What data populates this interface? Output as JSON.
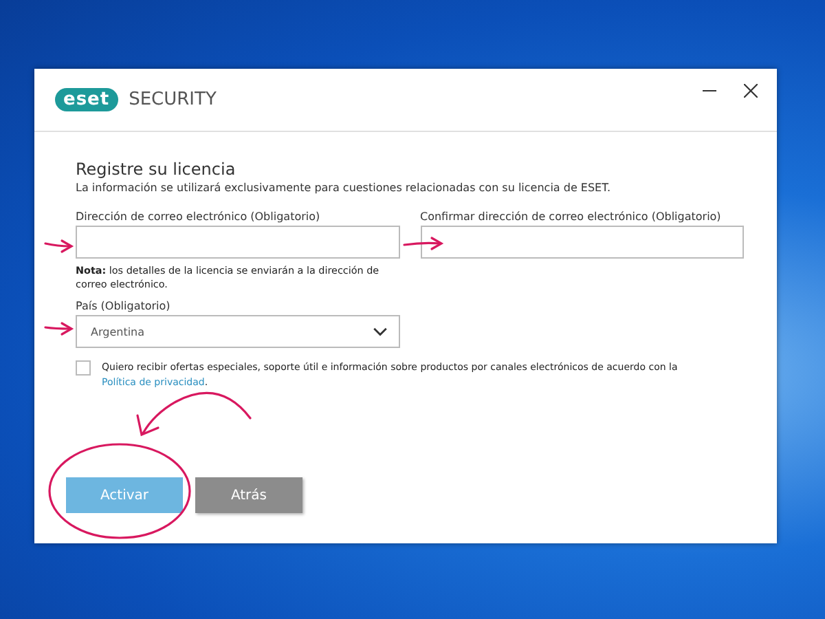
{
  "window": {
    "logo_mark": "eset",
    "logo_product": "SECURITY",
    "controls": [
      {
        "kind": "minimize"
      },
      {
        "kind": "close"
      }
    ]
  },
  "form": {
    "title": "Registre su licencia",
    "subtitle": "La información se utilizará exclusivamente para cuestiones relacionadas con su licencia de ESET.",
    "email": {
      "label": "Dirección de correo electrónico (Obligatorio)"
    },
    "confirm_email": {
      "label": "Confirmar dirección de correo electrónico (Obligatorio)"
    },
    "note": "**Nota:** los detalles de la licencia se enviarán a la dirección de correo electrónico.",
    "country": {
      "label": "País (Obligatorio)",
      "value": "Argentina"
    },
    "offers": {
      "checked": false,
      "text": "Quiero recibir ofertas especiales, soporte útil e información sobre productos por canales electrónicos de acuerdo con la",
      "link": "Política de privacidad",
      "after": "."
    }
  },
  "buttons": [
    {
      "label": "Activar",
      "kind": "primary"
    },
    {
      "label": "Atrás",
      "kind": "secondary"
    }
  ]
}
